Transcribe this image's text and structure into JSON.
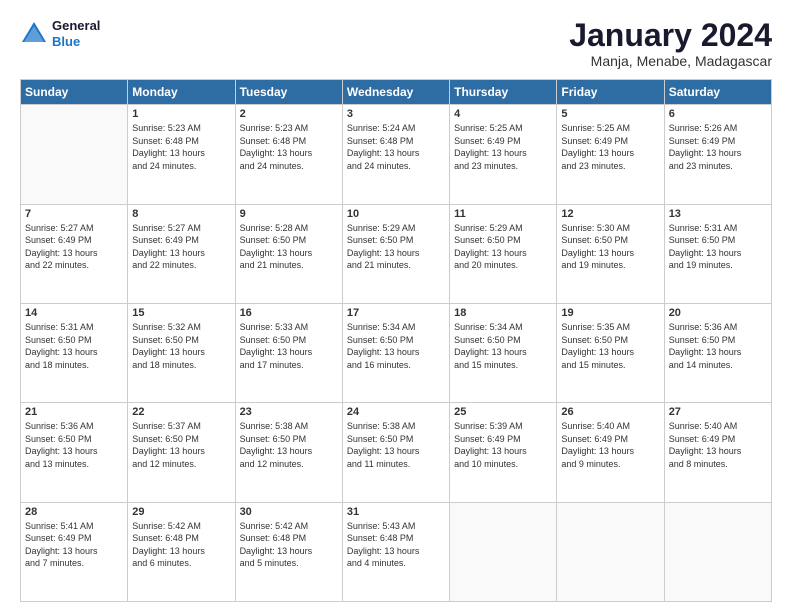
{
  "logo": {
    "text_general": "General",
    "text_blue": "Blue"
  },
  "header": {
    "title": "January 2024",
    "subtitle": "Manja, Menabe, Madagascar"
  },
  "weekdays": [
    "Sunday",
    "Monday",
    "Tuesday",
    "Wednesday",
    "Thursday",
    "Friday",
    "Saturday"
  ],
  "weeks": [
    [
      {
        "day": "",
        "info": ""
      },
      {
        "day": "1",
        "info": "Sunrise: 5:23 AM\nSunset: 6:48 PM\nDaylight: 13 hours\nand 24 minutes."
      },
      {
        "day": "2",
        "info": "Sunrise: 5:23 AM\nSunset: 6:48 PM\nDaylight: 13 hours\nand 24 minutes."
      },
      {
        "day": "3",
        "info": "Sunrise: 5:24 AM\nSunset: 6:48 PM\nDaylight: 13 hours\nand 24 minutes."
      },
      {
        "day": "4",
        "info": "Sunrise: 5:25 AM\nSunset: 6:49 PM\nDaylight: 13 hours\nand 23 minutes."
      },
      {
        "day": "5",
        "info": "Sunrise: 5:25 AM\nSunset: 6:49 PM\nDaylight: 13 hours\nand 23 minutes."
      },
      {
        "day": "6",
        "info": "Sunrise: 5:26 AM\nSunset: 6:49 PM\nDaylight: 13 hours\nand 23 minutes."
      }
    ],
    [
      {
        "day": "7",
        "info": "Sunrise: 5:27 AM\nSunset: 6:49 PM\nDaylight: 13 hours\nand 22 minutes."
      },
      {
        "day": "8",
        "info": "Sunrise: 5:27 AM\nSunset: 6:49 PM\nDaylight: 13 hours\nand 22 minutes."
      },
      {
        "day": "9",
        "info": "Sunrise: 5:28 AM\nSunset: 6:50 PM\nDaylight: 13 hours\nand 21 minutes."
      },
      {
        "day": "10",
        "info": "Sunrise: 5:29 AM\nSunset: 6:50 PM\nDaylight: 13 hours\nand 21 minutes."
      },
      {
        "day": "11",
        "info": "Sunrise: 5:29 AM\nSunset: 6:50 PM\nDaylight: 13 hours\nand 20 minutes."
      },
      {
        "day": "12",
        "info": "Sunrise: 5:30 AM\nSunset: 6:50 PM\nDaylight: 13 hours\nand 19 minutes."
      },
      {
        "day": "13",
        "info": "Sunrise: 5:31 AM\nSunset: 6:50 PM\nDaylight: 13 hours\nand 19 minutes."
      }
    ],
    [
      {
        "day": "14",
        "info": "Sunrise: 5:31 AM\nSunset: 6:50 PM\nDaylight: 13 hours\nand 18 minutes."
      },
      {
        "day": "15",
        "info": "Sunrise: 5:32 AM\nSunset: 6:50 PM\nDaylight: 13 hours\nand 18 minutes."
      },
      {
        "day": "16",
        "info": "Sunrise: 5:33 AM\nSunset: 6:50 PM\nDaylight: 13 hours\nand 17 minutes."
      },
      {
        "day": "17",
        "info": "Sunrise: 5:34 AM\nSunset: 6:50 PM\nDaylight: 13 hours\nand 16 minutes."
      },
      {
        "day": "18",
        "info": "Sunrise: 5:34 AM\nSunset: 6:50 PM\nDaylight: 13 hours\nand 15 minutes."
      },
      {
        "day": "19",
        "info": "Sunrise: 5:35 AM\nSunset: 6:50 PM\nDaylight: 13 hours\nand 15 minutes."
      },
      {
        "day": "20",
        "info": "Sunrise: 5:36 AM\nSunset: 6:50 PM\nDaylight: 13 hours\nand 14 minutes."
      }
    ],
    [
      {
        "day": "21",
        "info": "Sunrise: 5:36 AM\nSunset: 6:50 PM\nDaylight: 13 hours\nand 13 minutes."
      },
      {
        "day": "22",
        "info": "Sunrise: 5:37 AM\nSunset: 6:50 PM\nDaylight: 13 hours\nand 12 minutes."
      },
      {
        "day": "23",
        "info": "Sunrise: 5:38 AM\nSunset: 6:50 PM\nDaylight: 13 hours\nand 12 minutes."
      },
      {
        "day": "24",
        "info": "Sunrise: 5:38 AM\nSunset: 6:50 PM\nDaylight: 13 hours\nand 11 minutes."
      },
      {
        "day": "25",
        "info": "Sunrise: 5:39 AM\nSunset: 6:49 PM\nDaylight: 13 hours\nand 10 minutes."
      },
      {
        "day": "26",
        "info": "Sunrise: 5:40 AM\nSunset: 6:49 PM\nDaylight: 13 hours\nand 9 minutes."
      },
      {
        "day": "27",
        "info": "Sunrise: 5:40 AM\nSunset: 6:49 PM\nDaylight: 13 hours\nand 8 minutes."
      }
    ],
    [
      {
        "day": "28",
        "info": "Sunrise: 5:41 AM\nSunset: 6:49 PM\nDaylight: 13 hours\nand 7 minutes."
      },
      {
        "day": "29",
        "info": "Sunrise: 5:42 AM\nSunset: 6:48 PM\nDaylight: 13 hours\nand 6 minutes."
      },
      {
        "day": "30",
        "info": "Sunrise: 5:42 AM\nSunset: 6:48 PM\nDaylight: 13 hours\nand 5 minutes."
      },
      {
        "day": "31",
        "info": "Sunrise: 5:43 AM\nSunset: 6:48 PM\nDaylight: 13 hours\nand 4 minutes."
      },
      {
        "day": "",
        "info": ""
      },
      {
        "day": "",
        "info": ""
      },
      {
        "day": "",
        "info": ""
      }
    ]
  ]
}
